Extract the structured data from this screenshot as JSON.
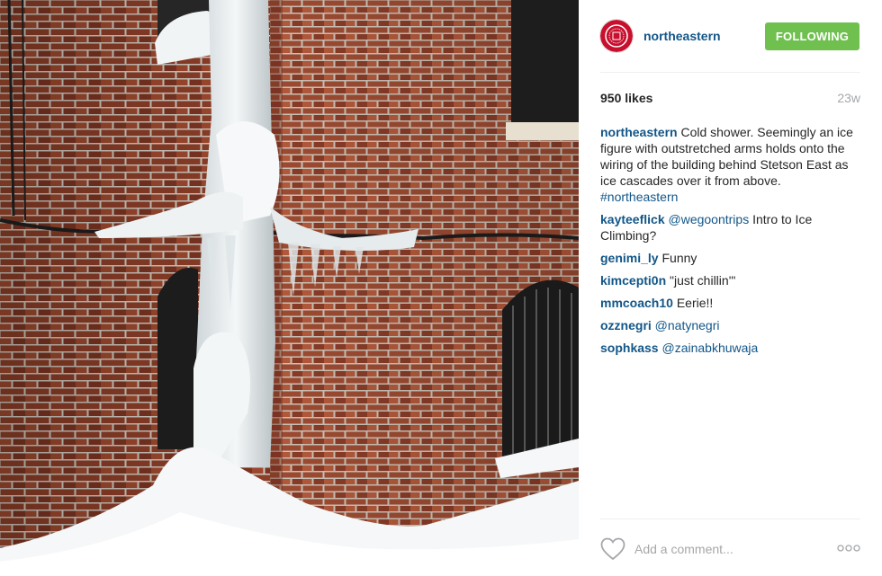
{
  "post": {
    "image_alt": "Ice cascading down a brick building corner",
    "username": "northeastern",
    "follow_label": "FOLLOWING",
    "likes": "950 likes",
    "timestamp": "23w",
    "caption": {
      "user": "northeastern",
      "text": " Cold shower. Seemingly an ice figure with outstretched arms holds onto the wiring of the building behind Stetson East as ice cascades over it from above. ",
      "hashtag": "#northeastern"
    },
    "comments": [
      {
        "user": "kayteeflick",
        "mention": "@wegoontrips",
        "text": " Intro to Ice Climbing?"
      },
      {
        "user": "genimi_ly",
        "mention": "",
        "text": " Funny"
      },
      {
        "user": "kimcepti0n",
        "mention": "",
        "text": " \"just chillin'\""
      },
      {
        "user": "mmcoach10",
        "mention": "",
        "text": " Eerie!!"
      },
      {
        "user": "ozznegri",
        "mention": "@natynegri",
        "text": ""
      },
      {
        "user": "sophkass",
        "mention": "@zainabkhuwaja",
        "text": ""
      }
    ],
    "add_comment_placeholder": "Add a comment..."
  },
  "icons": {
    "avatar": "northeastern-seal-logo",
    "like": "heart-outline-icon",
    "more": "more-options-icon"
  },
  "colors": {
    "link": "#125688",
    "follow_button": "#70c050",
    "muted": "#a5a7aa",
    "brand_red": "#c8102e"
  }
}
